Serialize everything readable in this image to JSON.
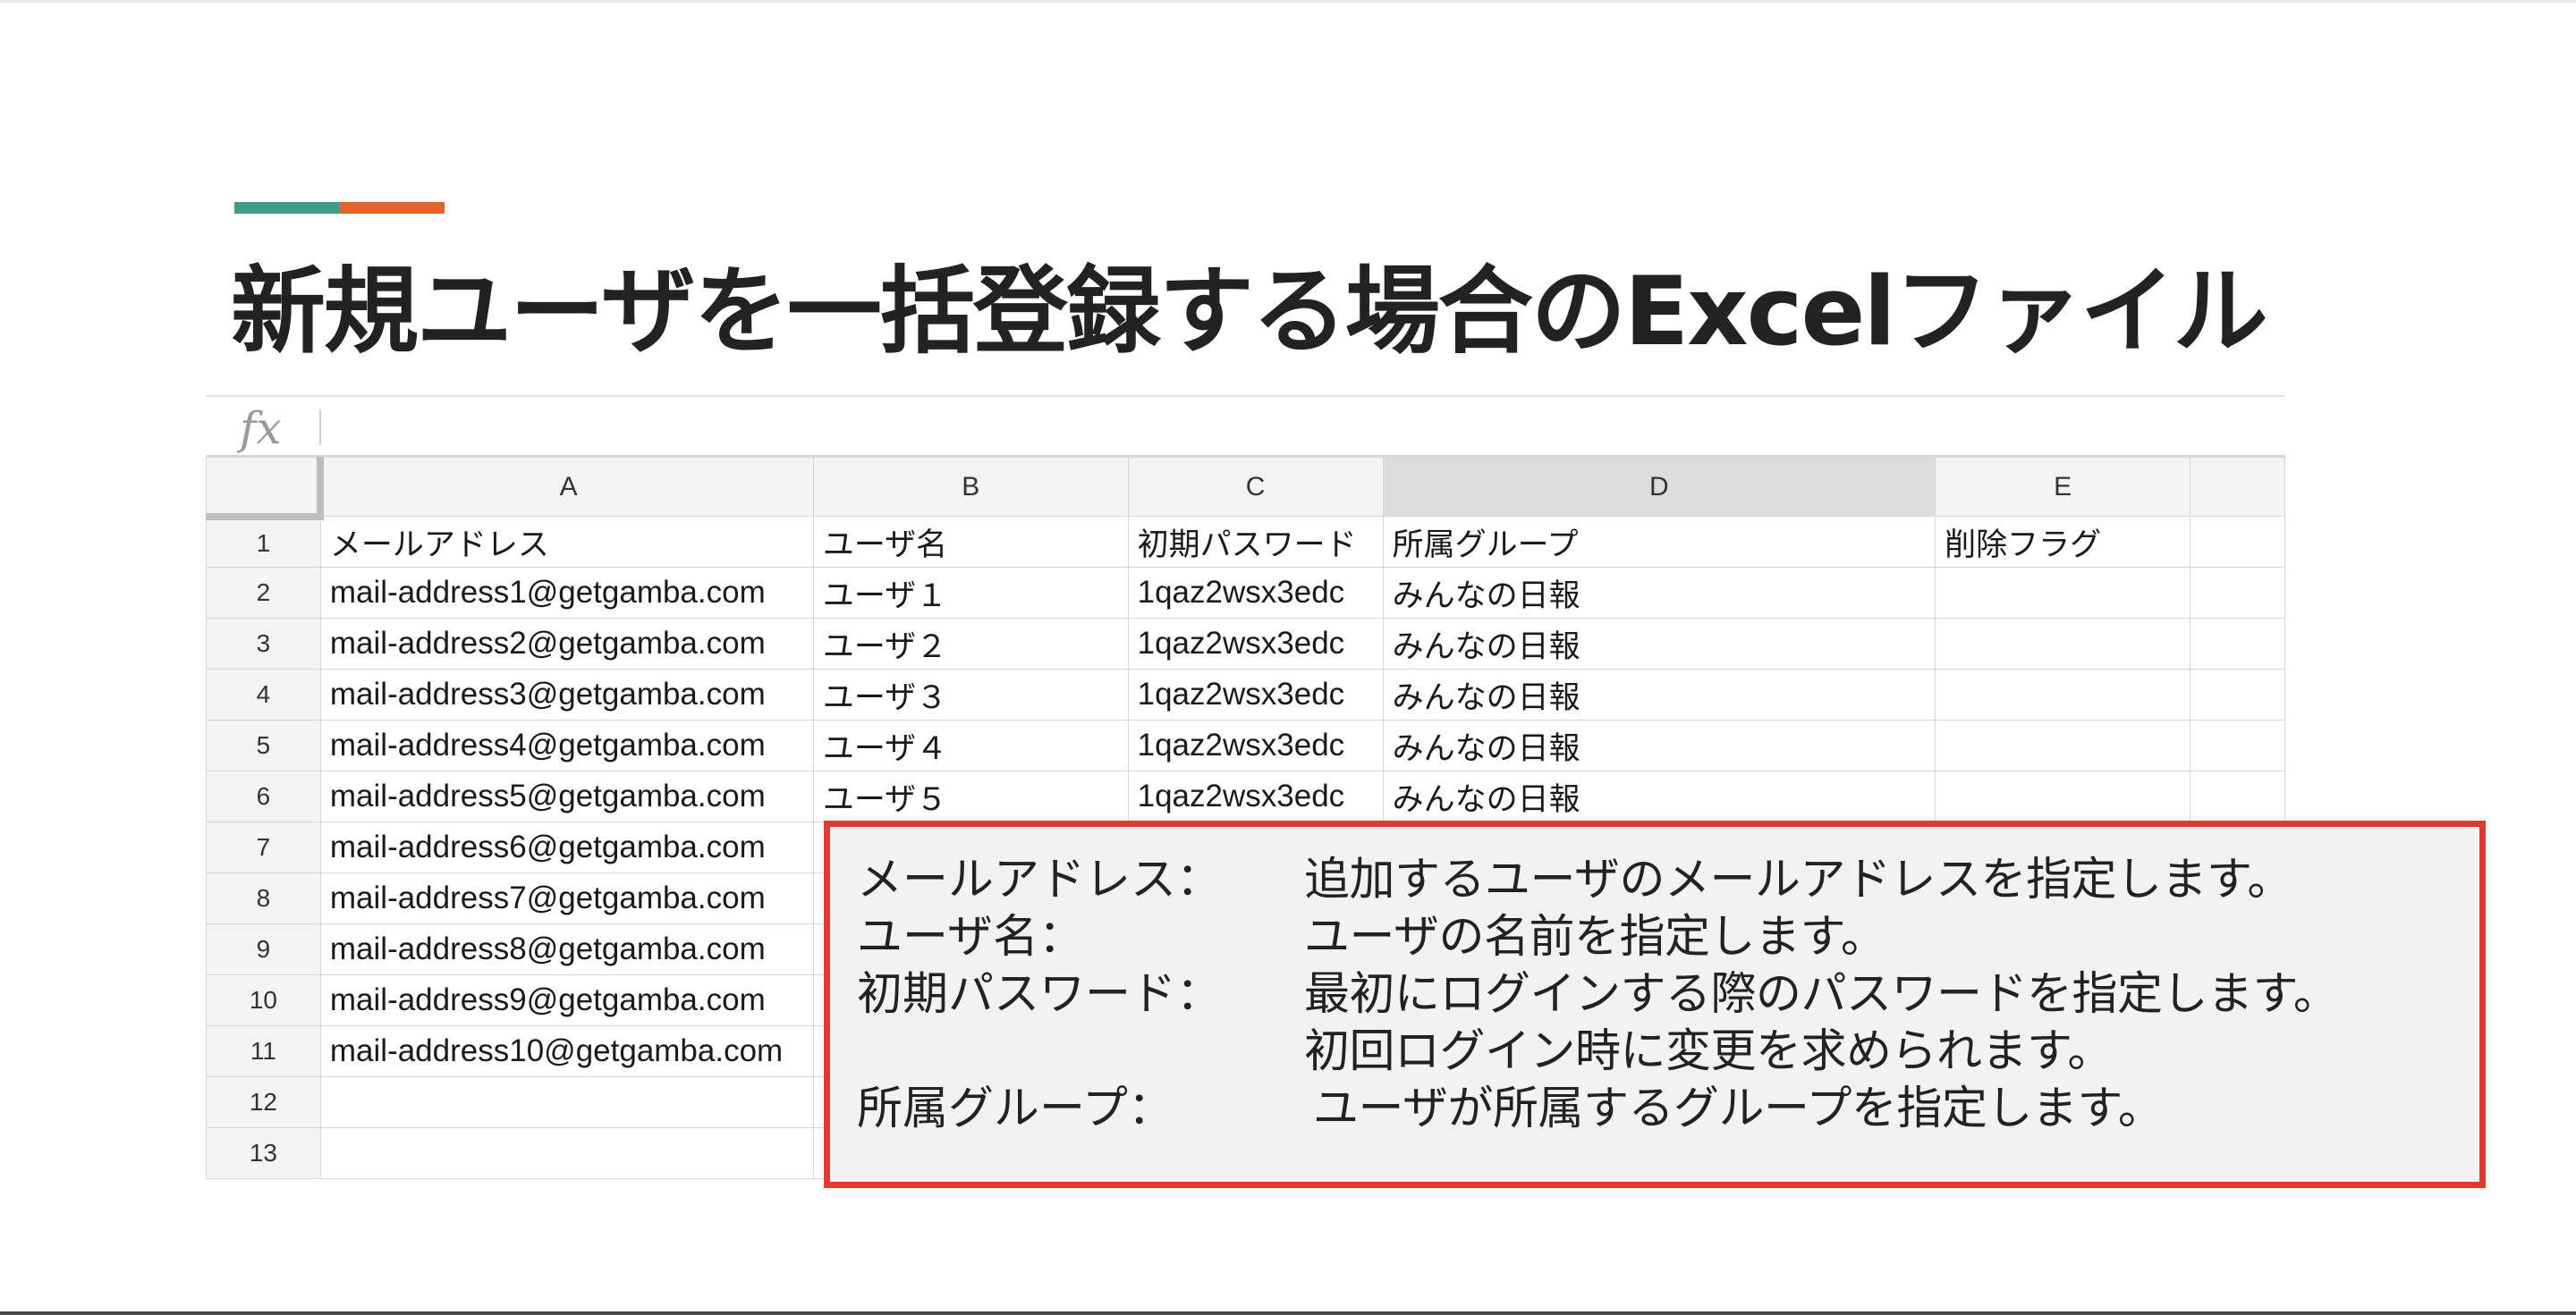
{
  "slide": {
    "title": "新規ユーザを一括登録する場合のExcelファイル",
    "accent_colors": {
      "teal": "#3f9a8a",
      "orange": "#e0632b"
    }
  },
  "sheet": {
    "fx_label": "fx",
    "columns": [
      "A",
      "B",
      "C",
      "D",
      "E"
    ],
    "row_numbers": [
      "1",
      "2",
      "3",
      "4",
      "5",
      "6",
      "7",
      "8",
      "9",
      "10",
      "11",
      "12",
      "13"
    ],
    "rows": [
      [
        "メールアドレス",
        "ユーザ名",
        "初期パスワード",
        "所属グループ",
        "削除フラグ"
      ],
      [
        "mail-address1@getgamba.com",
        "ユーザ１",
        "1qaz2wsx3edc",
        "みんなの日報",
        ""
      ],
      [
        "mail-address2@getgamba.com",
        "ユーザ２",
        "1qaz2wsx3edc",
        "みんなの日報",
        ""
      ],
      [
        "mail-address3@getgamba.com",
        "ユーザ３",
        "1qaz2wsx3edc",
        "みんなの日報",
        ""
      ],
      [
        "mail-address4@getgamba.com",
        "ユーザ４",
        "1qaz2wsx3edc",
        "みんなの日報",
        ""
      ],
      [
        "mail-address5@getgamba.com",
        "ユーザ５",
        "1qaz2wsx3edc",
        "みんなの日報",
        ""
      ],
      [
        "mail-address6@getgamba.com",
        "",
        "",
        "",
        ""
      ],
      [
        "mail-address7@getgamba.com",
        "",
        "",
        "",
        ""
      ],
      [
        "mail-address8@getgamba.com",
        "",
        "",
        "",
        ""
      ],
      [
        "mail-address9@getgamba.com",
        "",
        "",
        "",
        ""
      ],
      [
        "mail-address10@getgamba.com",
        "",
        "",
        "",
        ""
      ],
      [
        "",
        "",
        "",
        "",
        ""
      ],
      [
        "",
        "",
        "",
        "",
        ""
      ]
    ]
  },
  "callout": {
    "border_color": "#e03a2f",
    "lines": [
      {
        "key": "メールアドレス：",
        "value": "追加するユーザのメールアドレスを指定します。"
      },
      {
        "key": "ユーザ名：",
        "value": "ユーザの名前を指定します。"
      },
      {
        "key": "初期パスワード：",
        "value": "最初にログインする際のパスワードを指定します。"
      },
      {
        "key": "",
        "value": "初回ログイン時に変更を求められます。"
      },
      {
        "key": "所属グループ：",
        "value": "ユーザが所属するグループを指定します。"
      }
    ]
  }
}
